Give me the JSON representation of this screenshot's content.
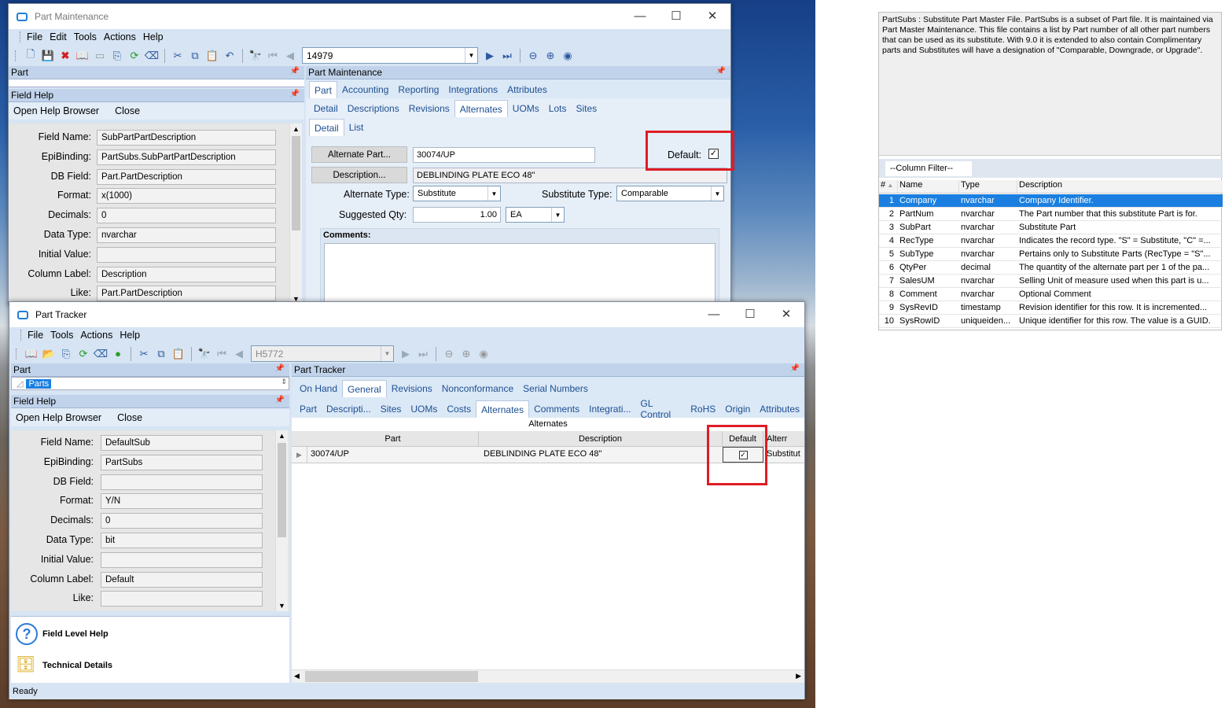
{
  "pm": {
    "title": "Part Maintenance",
    "menu": [
      "File",
      "Edit",
      "Tools",
      "Actions",
      "Help"
    ],
    "part_number": "14979",
    "part_pane": "Part",
    "field_help": "Field Help",
    "open_help": "Open Help Browser",
    "close": "Close",
    "fields": [
      {
        "label": "Field Name:",
        "value": "SubPartPartDescription"
      },
      {
        "label": "EpiBinding:",
        "value": "PartSubs.SubPartPartDescription"
      },
      {
        "label": "DB Field:",
        "value": "Part.PartDescription"
      },
      {
        "label": "Format:",
        "value": "x(1000)"
      },
      {
        "label": "Decimals:",
        "value": "0"
      },
      {
        "label": "Data Type:",
        "value": "nvarchar"
      },
      {
        "label": "Initial Value:",
        "value": ""
      },
      {
        "label": "Column Label:",
        "value": "Description"
      },
      {
        "label": "Like:",
        "value": "Part.PartDescription"
      }
    ],
    "main_pane": "Part Maintenance",
    "tabs1": [
      "Part",
      "Accounting",
      "Reporting",
      "Integrations",
      "Attributes"
    ],
    "tabs2": [
      "Detail",
      "Descriptions",
      "Revisions",
      "Alternates",
      "UOMs",
      "Lots",
      "Sites"
    ],
    "tabs3": [
      "Detail",
      "List"
    ],
    "alt_part_btn": "Alternate Part...",
    "alt_part_val": "30074/UP",
    "desc_btn": "Description...",
    "desc_val": "DEBLINDING PLATE ECO 48\"",
    "default_label": "Default:",
    "alt_type_label": "Alternate Type:",
    "alt_type_val": "Substitute",
    "sub_type_label": "Substitute Type:",
    "sub_type_val": "Comparable",
    "sugg_label": "Suggested Qty:",
    "sugg_val": "1.00",
    "uom": "EA",
    "comments": "Comments:"
  },
  "pt": {
    "title": "Part Tracker",
    "menu": [
      "File",
      "Tools",
      "Actions",
      "Help"
    ],
    "part_number": "H5772",
    "part_pane": "Part",
    "parts_node": "Parts",
    "field_help": "Field Help",
    "open_help": "Open Help Browser",
    "close": "Close",
    "fields": [
      {
        "label": "Field Name:",
        "value": "DefaultSub"
      },
      {
        "label": "EpiBinding:",
        "value": "PartSubs"
      },
      {
        "label": "DB Field:",
        "value": ""
      },
      {
        "label": "Format:",
        "value": "Y/N"
      },
      {
        "label": "Decimals:",
        "value": "0"
      },
      {
        "label": "Data Type:",
        "value": "bit"
      },
      {
        "label": "Initial Value:",
        "value": ""
      },
      {
        "label": "Column Label:",
        "value": "Default"
      },
      {
        "label": "Like:",
        "value": ""
      }
    ],
    "flh": "Field Level Help",
    "tech": "Technical Details",
    "status": "Ready",
    "main_pane": "Part Tracker",
    "tabs1": [
      "On Hand",
      "General",
      "Revisions",
      "Nonconformance",
      "Serial Numbers"
    ],
    "tabs2": [
      "Part",
      "Descripti...",
      "Sites",
      "UOMs",
      "Costs",
      "Alternates",
      "Comments",
      "Integrati...",
      "GL Control",
      "RoHS",
      "Origin",
      "Attributes"
    ],
    "grid_title": "Alternates",
    "cols": [
      "Part",
      "Description",
      "Default",
      "Alterr"
    ],
    "row": {
      "part": "30074/UP",
      "desc": "DEBLINDING PLATE ECO 48\"",
      "alt": "Substitut"
    }
  },
  "side": {
    "description": "PartSubs : Substitute Part Master File.  PartSubs is a subset of Part file. It is maintained via Part Master Maintenance.  This file contains a list by Part number of all other part numbers that can be used as its substitute.  With 9.0 it is extended to also contain Complimentary parts and Substitutes will have a  designation of \"Comparable, Downgrade, or Upgrade\".",
    "filter": "--Column Filter--",
    "headers": [
      "#",
      "Name",
      "Type",
      "Description"
    ],
    "rows": [
      {
        "n": "1",
        "name": "Company",
        "type": "nvarchar",
        "desc": "Company Identifier."
      },
      {
        "n": "2",
        "name": "PartNum",
        "type": "nvarchar",
        "desc": "The Part number that this substitute Part is for."
      },
      {
        "n": "3",
        "name": "SubPart",
        "type": "nvarchar",
        "desc": "Substitute Part"
      },
      {
        "n": "4",
        "name": "RecType",
        "type": "nvarchar",
        "desc": "Indicates the record type. \"S\" = Substitute, \"C\" =..."
      },
      {
        "n": "5",
        "name": "SubType",
        "type": "nvarchar",
        "desc": "Pertains only to Substitute Parts (RecType = \"S\"..."
      },
      {
        "n": "6",
        "name": "QtyPer",
        "type": "decimal",
        "desc": "The quantity of the alternate part per 1 of the pa..."
      },
      {
        "n": "7",
        "name": "SalesUM",
        "type": "nvarchar",
        "desc": "Selling Unit of measure used when this part is u..."
      },
      {
        "n": "8",
        "name": "Comment",
        "type": "nvarchar",
        "desc": "Optional Comment"
      },
      {
        "n": "9",
        "name": "SysRevID",
        "type": "timestamp",
        "desc": "Revision identifier for this row. It is incremented..."
      },
      {
        "n": "10",
        "name": "SysRowID",
        "type": "uniqueiden...",
        "desc": "Unique identifier for this row. The value is a GUID."
      }
    ]
  }
}
